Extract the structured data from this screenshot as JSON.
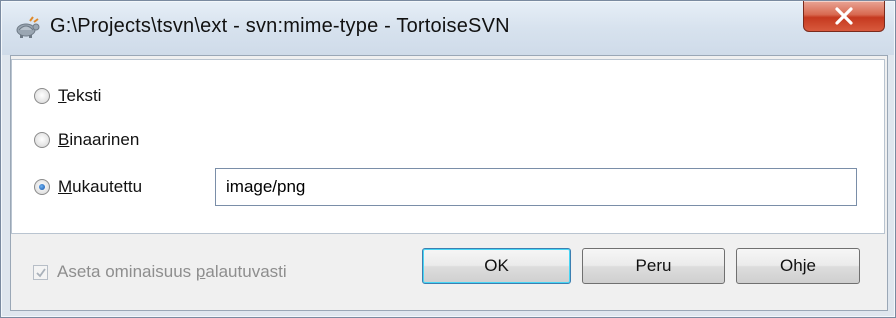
{
  "window": {
    "title": "G:\\Projects\\tsvn\\ext - svn:mime-type - TortoiseSVN"
  },
  "options": [
    {
      "label": "Teksti",
      "mnemonic": "T",
      "rest": "eksti",
      "checked": false
    },
    {
      "label": "Binaarinen",
      "mnemonic": "B",
      "rest": "inaarinen",
      "checked": false
    },
    {
      "label": "Mukautettu",
      "mnemonic": "M",
      "rest": "ukautettu",
      "checked": true
    }
  ],
  "custom_value": "image/png",
  "recursive": {
    "label_before": "Aseta ominaisuus ",
    "mnemonic": "p",
    "label_after": "alautuvasti",
    "checked": true,
    "enabled": false
  },
  "buttons": {
    "ok": "OK",
    "cancel": "Peru",
    "help": "Ohje"
  },
  "icons": {
    "app": "tortoisesvn-icon",
    "close": "close-icon"
  }
}
